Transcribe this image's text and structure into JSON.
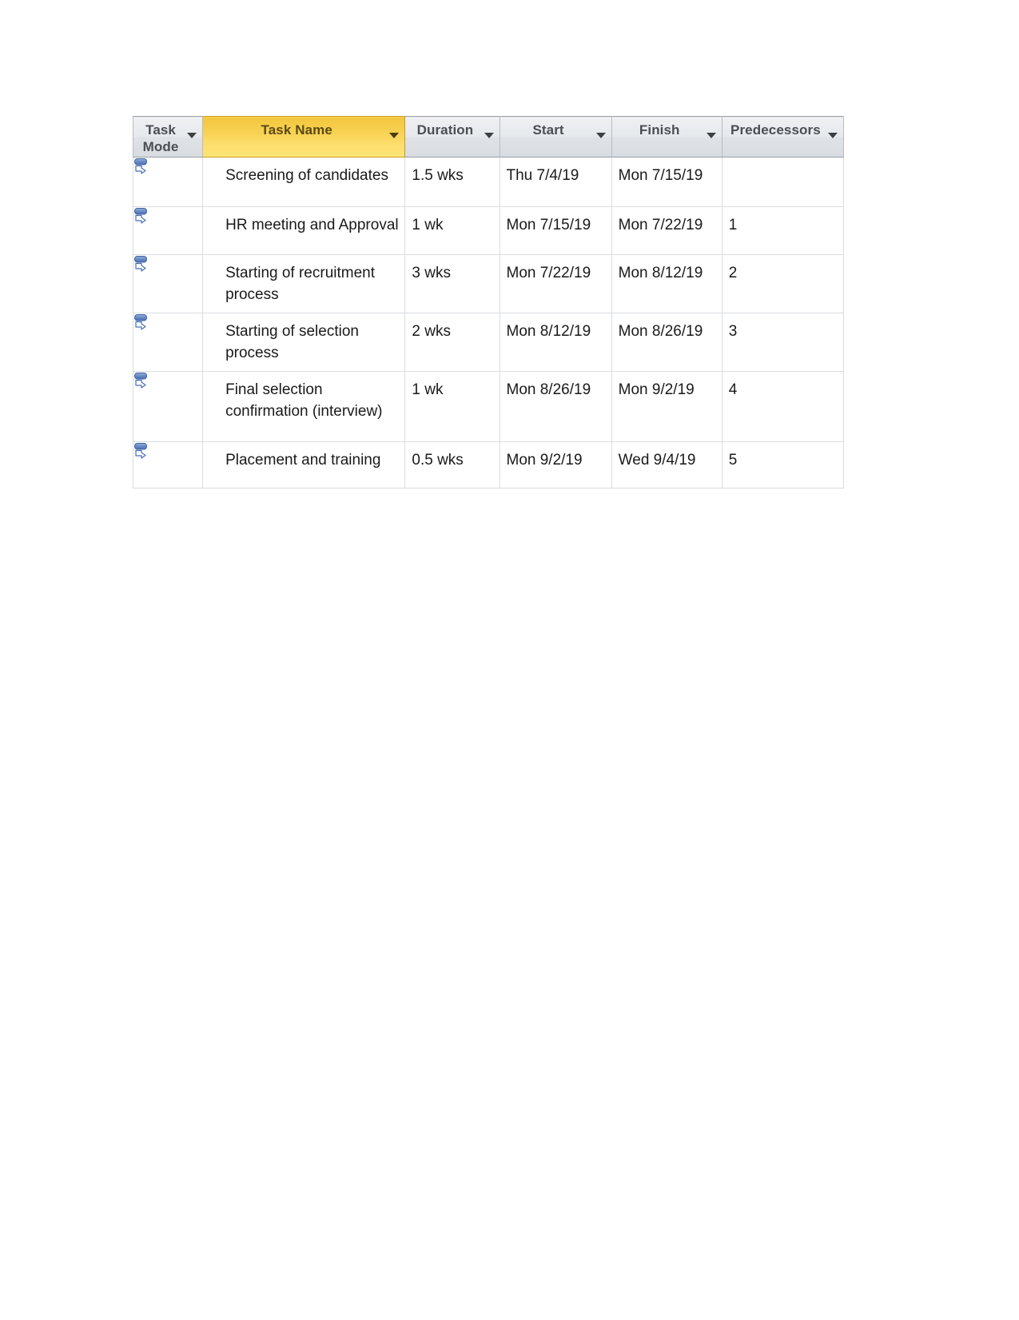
{
  "table": {
    "columns": [
      {
        "key": "task_mode",
        "label": "Task\nMode",
        "icon": "filter-dropdown-icon",
        "highlighted": false
      },
      {
        "key": "task_name",
        "label": "Task Name",
        "icon": "filter-dropdown-icon",
        "highlighted": true
      },
      {
        "key": "duration",
        "label": "Duration",
        "icon": "filter-dropdown-icon",
        "highlighted": false
      },
      {
        "key": "start",
        "label": "Start",
        "icon": "filter-dropdown-icon",
        "highlighted": false
      },
      {
        "key": "finish",
        "label": "Finish",
        "icon": "filter-dropdown-icon",
        "highlighted": false
      },
      {
        "key": "predecessors",
        "label": "Predecessors",
        "icon": "filter-dropdown-icon",
        "highlighted": false
      }
    ],
    "rows": [
      {
        "task_mode_icon": "manually-scheduled-task-icon",
        "task_name": "Screening of candidates",
        "duration": "1.5 wks",
        "start": "Thu 7/4/19",
        "finish": "Mon 7/15/19",
        "predecessors": ""
      },
      {
        "task_mode_icon": "manually-scheduled-task-icon",
        "task_name": "HR meeting and Approval",
        "duration": "1 wk",
        "start": "Mon 7/15/19",
        "finish": "Mon 7/22/19",
        "predecessors": "1"
      },
      {
        "task_mode_icon": "manually-scheduled-task-icon",
        "task_name": "Starting of recruitment process",
        "duration": "3 wks",
        "start": "Mon 7/22/19",
        "finish": "Mon 8/12/19",
        "predecessors": "2"
      },
      {
        "task_mode_icon": "manually-scheduled-task-icon",
        "task_name": "Starting of selection process",
        "duration": "2 wks",
        "start": "Mon 8/12/19",
        "finish": "Mon 8/26/19",
        "predecessors": "3"
      },
      {
        "task_mode_icon": "manually-scheduled-task-icon",
        "task_name": "Final selection confirmation (interview)",
        "duration": "1 wk",
        "start": "Mon 8/26/19",
        "finish": "Mon 9/2/19",
        "predecessors": "4"
      },
      {
        "task_mode_icon": "manually-scheduled-task-icon",
        "task_name": "Placement and training",
        "duration": "0.5 wks",
        "start": "Mon 9/2/19",
        "finish": "Wed 9/4/19",
        "predecessors": "5"
      }
    ]
  },
  "colors": {
    "highlight_header_top": "#f3c63f",
    "highlight_header_bottom": "#ffe477",
    "header_gray": "#e6e9ec",
    "grid_line": "#d9dcdf",
    "header_border": "#9aa0a6",
    "icon_blue": "#6f8fc9",
    "text": "#1a1a1a",
    "header_text": "#4a4f54"
  }
}
